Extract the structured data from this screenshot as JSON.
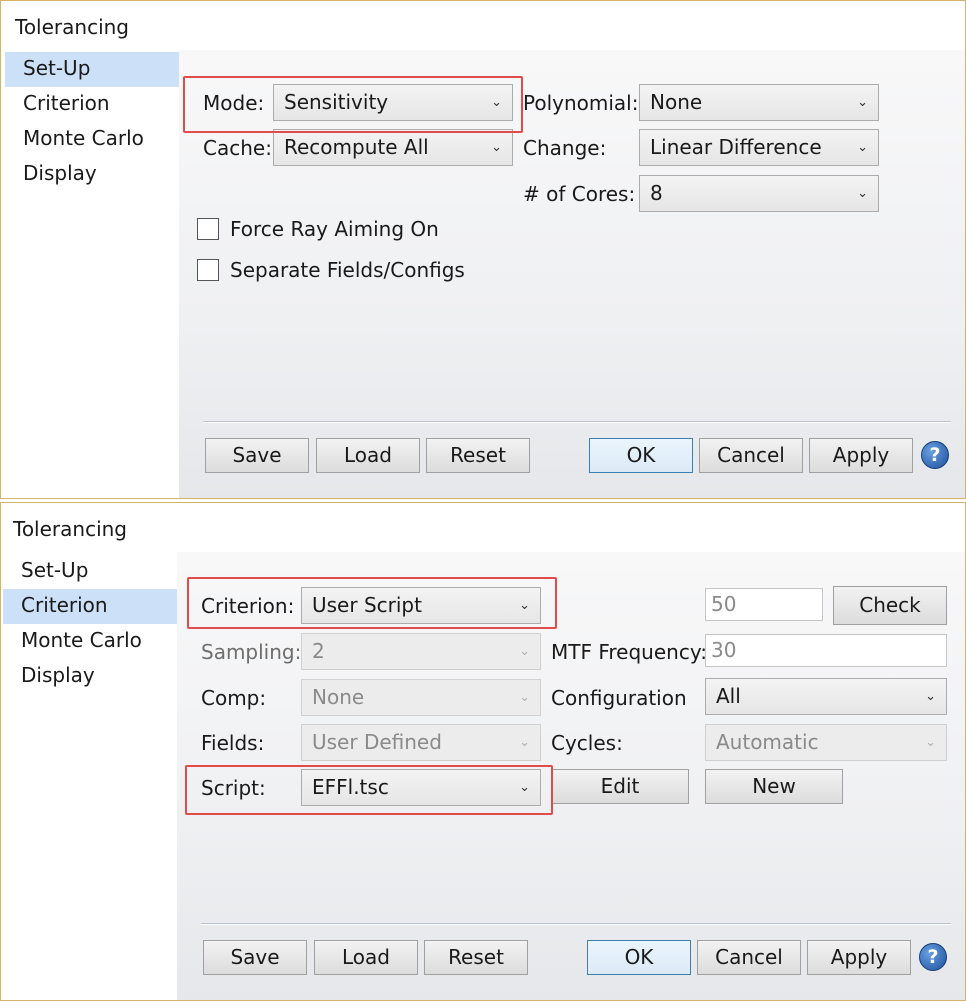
{
  "panel1": {
    "title": "Tolerancing",
    "nav": [
      "Set-Up",
      "Criterion",
      "Monte Carlo",
      "Display"
    ],
    "mode": {
      "label": "Mode:",
      "value": "Sensitivity"
    },
    "cache": {
      "label": "Cache:",
      "value": "Recompute All"
    },
    "polynomial": {
      "label": "Polynomial:",
      "value": "None"
    },
    "change": {
      "label": "Change:",
      "value": "Linear Difference"
    },
    "cores": {
      "label": "# of Cores:",
      "value": "8"
    },
    "force_ray_aiming": {
      "label": "Force Ray Aiming On",
      "checked": false
    },
    "separate_fields": {
      "label": "Separate Fields/Configs",
      "checked": false
    },
    "buttons": {
      "save": "Save",
      "load": "Load",
      "reset": "Reset",
      "ok": "OK",
      "cancel": "Cancel",
      "apply": "Apply"
    }
  },
  "panel2": {
    "title": "Tolerancing",
    "nav": [
      "Set-Up",
      "Criterion",
      "Monte Carlo",
      "Display"
    ],
    "criterion": {
      "label": "Criterion:",
      "value": "User Script"
    },
    "criterion_number": "50",
    "check_label": "Check",
    "sampling": {
      "label": "Sampling:",
      "value": "2"
    },
    "mtf_frequency": {
      "label": "MTF Frequency:",
      "value": "30"
    },
    "comp": {
      "label": "Comp:",
      "value": "None"
    },
    "configuration": {
      "label": "Configuration",
      "value": "All"
    },
    "fields": {
      "label": "Fields:",
      "value": "User Defined"
    },
    "cycles": {
      "label": "Cycles:",
      "value": "Automatic"
    },
    "script": {
      "label": "Script:",
      "value": "EFFl.tsc"
    },
    "edit_label": "Edit",
    "new_label": "New",
    "buttons": {
      "save": "Save",
      "load": "Load",
      "reset": "Reset",
      "ok": "OK",
      "cancel": "Cancel",
      "apply": "Apply"
    }
  },
  "icons": {
    "help": "?",
    "chevron": "⌄"
  },
  "colors": {
    "nav_selected": "#cce0f7",
    "highlight": "#e04c4c",
    "ok_border": "#3c7fb1",
    "panel_border": "#d9b26a"
  }
}
